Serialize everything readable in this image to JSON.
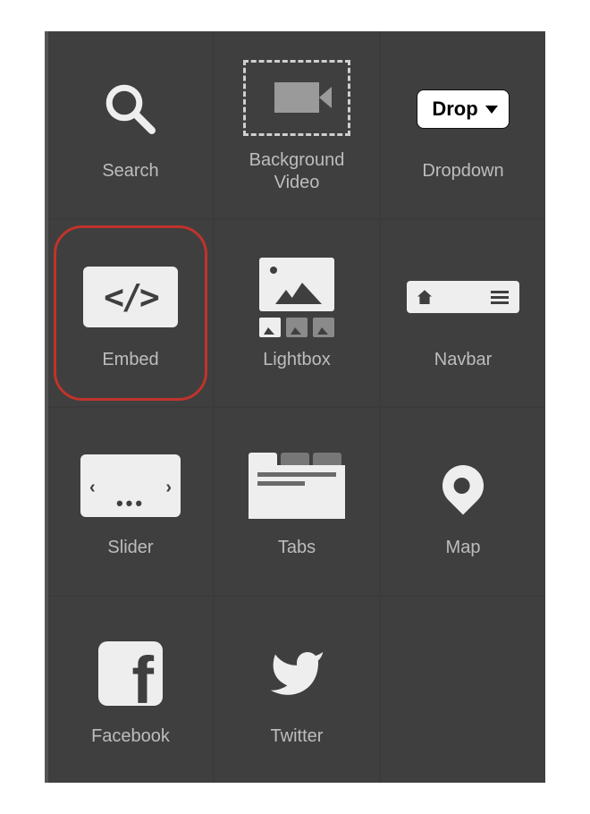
{
  "panel": {
    "items": [
      {
        "key": "search",
        "label": "Search",
        "highlighted": false
      },
      {
        "key": "bg-video",
        "label": "Background\nVideo",
        "highlighted": false
      },
      {
        "key": "dropdown",
        "label": "Dropdown",
        "highlighted": false,
        "button_text": "Drop"
      },
      {
        "key": "embed",
        "label": "Embed",
        "highlighted": true,
        "glyph": "</>"
      },
      {
        "key": "lightbox",
        "label": "Lightbox",
        "highlighted": false
      },
      {
        "key": "navbar",
        "label": "Navbar",
        "highlighted": false
      },
      {
        "key": "slider",
        "label": "Slider",
        "highlighted": false
      },
      {
        "key": "tabs",
        "label": "Tabs",
        "highlighted": false
      },
      {
        "key": "map",
        "label": "Map",
        "highlighted": false
      },
      {
        "key": "facebook",
        "label": "Facebook",
        "highlighted": false
      },
      {
        "key": "twitter",
        "label": "Twitter",
        "highlighted": false
      }
    ]
  },
  "colors": {
    "panel_bg": "#3f3f3f",
    "highlight_border": "#c0332b",
    "text": "#bdbdbd",
    "icon_light": "#eeeeee"
  }
}
